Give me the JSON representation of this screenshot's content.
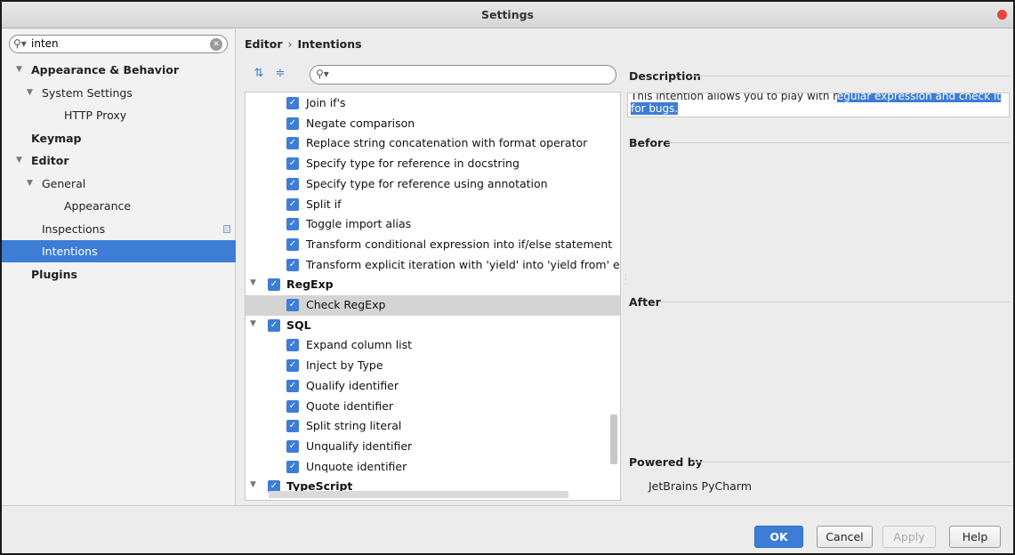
{
  "window": {
    "title": "Settings"
  },
  "sidebar": {
    "search_value": "inten",
    "items": [
      {
        "label": "Appearance & Behavior",
        "bold": true,
        "level": 0,
        "expanded": true
      },
      {
        "label": "System Settings",
        "bold": false,
        "level": 1,
        "expanded": true
      },
      {
        "label": "HTTP Proxy",
        "bold": false,
        "level": 2
      },
      {
        "label": "Keymap",
        "bold": true,
        "level": 0
      },
      {
        "label": "Editor",
        "bold": true,
        "level": 0,
        "expanded": true
      },
      {
        "label": "General",
        "bold": false,
        "level": 1,
        "expanded": true
      },
      {
        "label": "Appearance",
        "bold": false,
        "level": 2
      },
      {
        "label": "Inspections",
        "bold": false,
        "level": 1
      },
      {
        "label": "Intentions",
        "bold": false,
        "level": 1,
        "selected": true
      },
      {
        "label": "Plugins",
        "bold": true,
        "level": 0
      }
    ]
  },
  "breadcrumb": {
    "parent": "Editor",
    "separator": "›",
    "current": "Intentions"
  },
  "intentions": [
    {
      "label": "Join if's",
      "group": false
    },
    {
      "label": "Negate comparison",
      "group": false
    },
    {
      "label": "Replace string concatenation with format operator",
      "group": false
    },
    {
      "label": "Specify type for reference in docstring",
      "group": false
    },
    {
      "label": "Specify type for reference using annotation",
      "group": false
    },
    {
      "label": "Split if",
      "group": false
    },
    {
      "label": "Toggle import alias",
      "group": false
    },
    {
      "label": "Transform conditional expression into if/else statement",
      "group": false
    },
    {
      "label": "Transform explicit iteration with 'yield' into 'yield from' expre",
      "group": false
    },
    {
      "label": "RegExp",
      "group": true
    },
    {
      "label": "Check RegExp",
      "group": false,
      "highlighted": true
    },
    {
      "label": "SQL",
      "group": true
    },
    {
      "label": "Expand column list",
      "group": false
    },
    {
      "label": "Inject by Type",
      "group": false
    },
    {
      "label": "Qualify identifier",
      "group": false
    },
    {
      "label": "Quote identifier",
      "group": false
    },
    {
      "label": "Split string literal",
      "group": false
    },
    {
      "label": "Unqualify identifier",
      "group": false
    },
    {
      "label": "Unquote identifier",
      "group": false
    },
    {
      "label": "TypeScript",
      "group": true
    }
  ],
  "details": {
    "description_label": "Description",
    "description_plain": "This intention allows you to play with r",
    "description_selected": "egular expression and check it for bugs.",
    "before_label": "Before",
    "after_label": "After",
    "powered_label": "Powered by",
    "powered_value": "JetBrains PyCharm"
  },
  "buttons": {
    "ok": "OK",
    "cancel": "Cancel",
    "apply": "Apply",
    "help": "Help"
  },
  "colors": {
    "accent": "#3d7dd6",
    "close_dot": "#e8453c"
  }
}
